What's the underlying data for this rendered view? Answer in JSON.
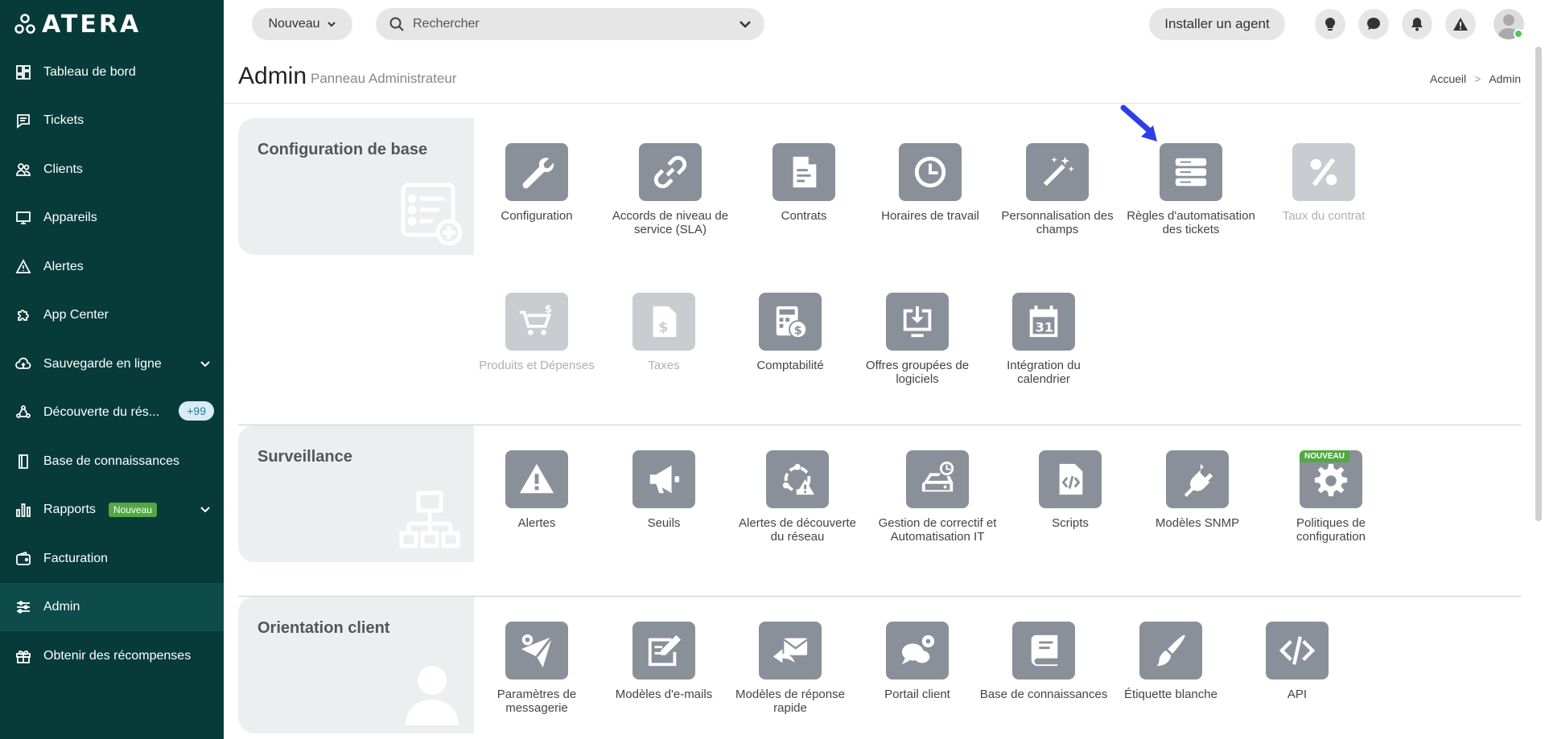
{
  "app": {
    "logo_text": "ATERA"
  },
  "sidebar": {
    "items": [
      {
        "label": "Tableau de bord",
        "icon": "dashboard-icon"
      },
      {
        "label": "Tickets",
        "icon": "ticket-icon"
      },
      {
        "label": "Clients",
        "icon": "users-icon"
      },
      {
        "label": "Appareils",
        "icon": "monitor-icon"
      },
      {
        "label": "Alertes",
        "icon": "warning-icon"
      },
      {
        "label": "App Center",
        "icon": "puzzle-icon"
      },
      {
        "label": "Sauvegarde en ligne",
        "icon": "cloud-icon"
      },
      {
        "label": "Découverte du rés...",
        "icon": "network-icon",
        "count": "+99"
      },
      {
        "label": "Base de connaissances",
        "icon": "book-icon"
      },
      {
        "label": "Rapports",
        "icon": "chart-icon",
        "badge": "Nouveau"
      },
      {
        "label": "Facturation",
        "icon": "wallet-icon"
      },
      {
        "label": "Admin",
        "icon": "sliders-icon"
      },
      {
        "label": "Obtenir des récompenses",
        "icon": "gift-icon"
      }
    ]
  },
  "topbar": {
    "new_label": "Nouveau",
    "search_placeholder": "Rechercher",
    "install_agent_label": "Installer un agent"
  },
  "header": {
    "title": "Admin",
    "subtitle": "Panneau Administrateur",
    "breadcrumb_home": "Accueil",
    "breadcrumb_sep": ">",
    "breadcrumb_current": "Admin"
  },
  "sections": {
    "base": {
      "title": "Configuration de base",
      "tiles": [
        "Configuration",
        "Accords de niveau de service (SLA)",
        "Contrats",
        "Horaires de travail",
        "Personnalisation des champs",
        "Règles d'automatisation des tickets",
        "Taux du contrat",
        "Produits et Dépenses",
        "Taxes",
        "Comptabilité",
        "Offres groupées de logiciels",
        "Intégration du calendrier"
      ]
    },
    "monitoring": {
      "title": "Surveillance",
      "tiles": [
        "Alertes",
        "Seuils",
        "Alertes de découverte du réseau",
        "Gestion de correctif et Automatisation IT",
        "Scripts",
        "Modèles SNMP",
        "Politiques de configuration"
      ],
      "new_badge": "NOUVEAU"
    },
    "client": {
      "title": "Orientation client",
      "tiles": [
        "Paramètres de messagerie",
        "Modèles d'e-mails",
        "Modèles de réponse rapide",
        "Portail client",
        "Base de connaissances",
        "Étiquette blanche",
        "API"
      ]
    }
  }
}
